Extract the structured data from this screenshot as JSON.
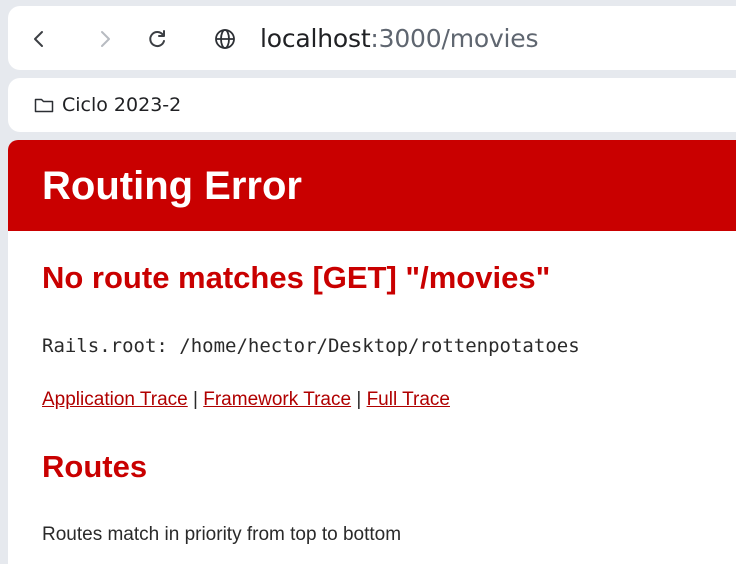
{
  "browser": {
    "url_host": "localhost",
    "url_rest": ":3000/movies",
    "icons": {
      "back": "back-arrow-icon",
      "forward": "forward-arrow-icon",
      "reload": "reload-icon",
      "site_info": "globe-icon"
    }
  },
  "bookmarks": {
    "items": [
      {
        "label": "Ciclo 2023-2",
        "icon": "folder-icon"
      }
    ]
  },
  "page": {
    "header_title": "Routing Error",
    "error_message": "No route matches [GET] \"/movies\"",
    "rails_root": "Rails.root: /home/hector/Desktop/rottenpotatoes",
    "traces": {
      "application": "Application Trace",
      "framework": "Framework Trace",
      "full": "Full Trace",
      "separator": "|"
    },
    "routes_heading": "Routes",
    "routes_note": "Routes match in priority from top to bottom"
  },
  "colors": {
    "header_bg": "#c90000",
    "heading_text": "#c90000",
    "link": "#b00000",
    "chrome_bg": "#e6e9ee"
  }
}
